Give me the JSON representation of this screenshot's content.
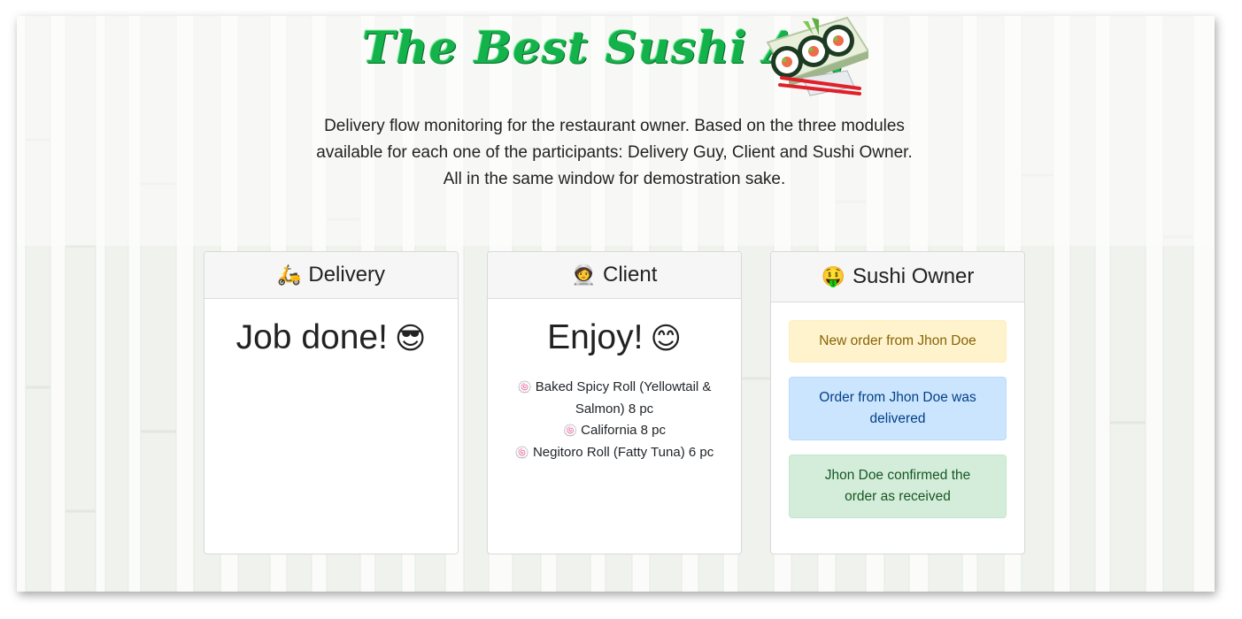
{
  "header": {
    "title": "The Best Sushi App",
    "logo_icon": "sushi-roll-icon",
    "intro": "Delivery flow monitoring for the restaurant owner. Based on the three modules available for each one of the participants: Delivery Guy, Client and Sushi Owner. All in the same window for demostration sake."
  },
  "delivery": {
    "icon": "scooter-icon",
    "icon_glyph": "🛵",
    "title": "Delivery",
    "status": "Job done!",
    "status_icon": "sunglasses-face-icon",
    "status_glyph": "😎"
  },
  "client": {
    "icon": "astronaut-icon",
    "icon_glyph": "🧑‍🚀",
    "title": "Client",
    "status": "Enjoy!",
    "status_icon": "smiling-face-icon",
    "status_glyph": "😊",
    "item_icon_glyph": "🍥",
    "items": [
      "Baked Spicy Roll (Yellowtail & Salmon) 8 pc",
      "California 8 pc",
      "Negitoro Roll (Fatty Tuna) 6 pc"
    ]
  },
  "owner": {
    "icon": "money-mouth-face-icon",
    "icon_glyph": "🤑",
    "title": "Sushi Owner",
    "notifications": [
      {
        "text": "New order from Jhon Doe",
        "type": "warning"
      },
      {
        "text": "Order from Jhon Doe was delivered",
        "type": "primary"
      },
      {
        "text": "Jhon Doe confirmed the order as received",
        "type": "success"
      }
    ]
  },
  "colors": {
    "title_green": "#13b24a",
    "warning_bg": "#fff3cd",
    "primary_bg": "#cce5ff",
    "success_bg": "#d4edda"
  }
}
